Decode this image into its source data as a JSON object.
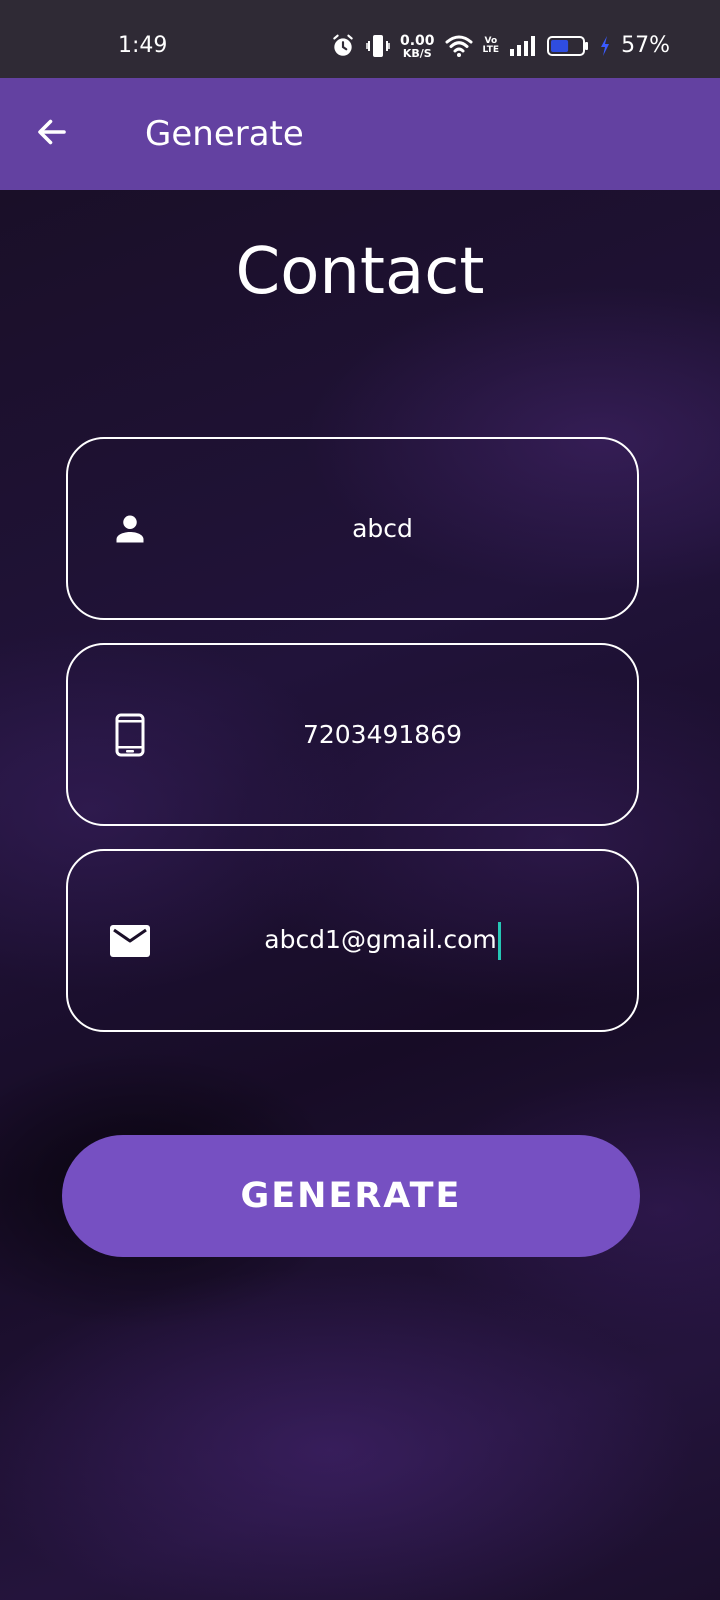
{
  "status_bar": {
    "time": "1:49",
    "net_speed_value": "0.00",
    "net_speed_unit": "KB/S",
    "volte_top": "Vo",
    "volte_bottom": "LTE",
    "battery_percent": "57%",
    "battery_level_fraction": 0.57,
    "icons": [
      "alarm-icon",
      "vibrate-icon",
      "wifi-icon",
      "signal-icon",
      "battery-icon",
      "charging-icon"
    ]
  },
  "app_bar": {
    "title": "Generate",
    "back_icon": "arrow-left-icon"
  },
  "main": {
    "title": "Contact",
    "fields": [
      {
        "icon": "person-icon",
        "value": "abcd"
      },
      {
        "icon": "phone-icon",
        "value": "7203491869"
      },
      {
        "icon": "mail-icon",
        "value": "abcd1@gmail.com"
      }
    ],
    "generate_label": "GENERATE"
  },
  "colors": {
    "status_bar_bg": "#2f2a35",
    "app_bar_bg": "#6341a1",
    "button_bg": "#7650c2",
    "caret": "#26c6b5",
    "battery_fill": "#2f4de0",
    "charging_bolt": "#3a5bff"
  }
}
